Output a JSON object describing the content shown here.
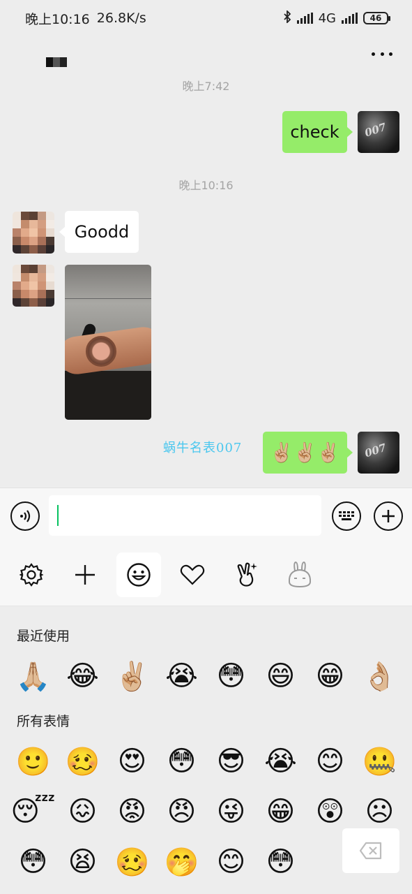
{
  "status_bar": {
    "time": "晚上10:16",
    "speed": "26.8K/s",
    "network": "4G",
    "battery": "46"
  },
  "chat": {
    "messages": [
      {
        "timestamp": "晚上7:42"
      },
      {
        "from": "self",
        "text": "check"
      },
      {
        "timestamp": "晚上10:16"
      },
      {
        "from": "other",
        "text": "Goodd"
      },
      {
        "from": "other",
        "type": "image"
      },
      {
        "from": "self",
        "text": "✌🏼✌🏼✌🏼"
      }
    ],
    "self_avatar_text": "007",
    "watermark": "蜗牛名表007"
  },
  "input": {
    "value": ""
  },
  "emoji_panel": {
    "recent_title": "最近使用",
    "recent": [
      "🙏🏼",
      "😂",
      "✌🏼",
      "😭",
      "😳",
      "😄",
      "😁",
      "👌🏼"
    ],
    "all_title": "所有表情",
    "all": [
      "🙂",
      "🥴",
      "😍",
      "😳",
      "😎",
      "😭",
      "😊",
      "🤐",
      "😴",
      "😖",
      "😡",
      "😠",
      "😜",
      "😁",
      "😲",
      "☹",
      "😳",
      "😫",
      "🥴",
      "🤭",
      "😊",
      "😳"
    ]
  },
  "colors": {
    "bubble_out": "#95ec69",
    "bubble_in": "#ffffff",
    "background": "#ededed",
    "caret": "#07c160",
    "watermark": "#4bc7ee"
  }
}
